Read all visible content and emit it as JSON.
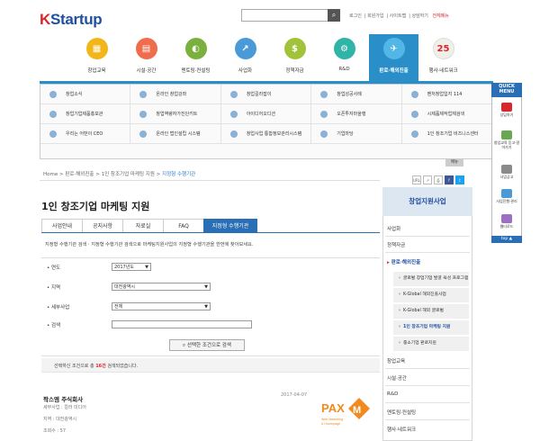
{
  "logo": {
    "k": "K",
    "rest": "Startup"
  },
  "search": {
    "placeholder": "",
    "icon": "search-icon"
  },
  "toplinks": [
    "로그인",
    "회원가입",
    "사이트맵",
    "상담하기",
    "전체메뉴"
  ],
  "gnb": [
    {
      "label": "창업교육",
      "color": "#f2b619",
      "glyph": "▦"
    },
    {
      "label": "시설·공간",
      "color": "#ef6c4c",
      "glyph": "▤"
    },
    {
      "label": "멘토링·컨설팅",
      "color": "#7ab13e",
      "glyph": "◐"
    },
    {
      "label": "사업화",
      "color": "#4b9ad8",
      "glyph": "↗"
    },
    {
      "label": "정책자금",
      "color": "#a0c33a",
      "glyph": "$"
    },
    {
      "label": "R&D",
      "color": "#2fb4a7",
      "glyph": "⚙"
    },
    {
      "label": "판로·해외진출",
      "color": "#52b7e6",
      "glyph": "✈"
    },
    {
      "label": "행사·네트워크",
      "color": "#f0efe8",
      "glyph": "25"
    }
  ],
  "submenu": [
    [
      "창업소식",
      "온라인 창업강좌",
      "창업길라잡이",
      "창업성공사례",
      "벤처창업입지 114"
    ],
    [
      "창업기업제품홍보관",
      "창업역량자가진단키트",
      "아이디어오디션",
      "오픈투자마을행",
      "시제품제작업체검색"
    ],
    [
      "우리는 어떤이 CEO",
      "온라인 법인설립 시스템",
      "창업사업 통합정보관리시스템",
      "기업마당",
      "1인 창조기업 비즈니스센터"
    ]
  ],
  "menu_tag": "메뉴",
  "breadcrumb": {
    "home": "Home",
    "p1": "판로·해외진출",
    "p2": "1인 창조기업 마케팅 지원",
    "current": "지정형 수행기관"
  },
  "share": [
    "URL",
    "",
    "",
    "f",
    "t"
  ],
  "page_title": "1인 창조기업 마케팅 지원",
  "tabs": [
    "사업안내",
    "공지사항",
    "자료실",
    "FAQ",
    "지정형 수행기관"
  ],
  "description": "지정형 수행기관 검색 · 지정형 수행기관 검색으로 마케팅지원사업의 지정형 수행기관을 한번에 찾아보세요.",
  "form": {
    "year_label": "연도",
    "year_value": "2017년도",
    "region_label": "지역",
    "region_value": "대전광역시",
    "detail_label": "세부사업",
    "detail_value": "전체",
    "keyword_label": "검색",
    "keyword_value": ""
  },
  "search_button": "선택한 조건으로 검색",
  "result": {
    "pre": "선택하신 조건으로 총",
    "count": "16건",
    "post": "검색되었습니다."
  },
  "item": {
    "title": "팍스엠 주식회사",
    "date": "2017-04-07",
    "meta1": "세부사업 : 컬러 미디어",
    "meta2": "지역 : 대전광역시",
    "meta3": "조회수 : 57",
    "logo": "PAXM",
    "logo_sub": "Web Marketing & Homepage"
  },
  "sidebar": {
    "title": "창업지원사업",
    "items": [
      "사업화",
      "정책자금",
      "판로·해외진출"
    ],
    "subs": [
      "글로벌 창업기업 발굴 육성 프로그램",
      "K-Global 해외진출사업",
      "K-Global 해외 글로벌",
      "1인 창조기업 마케팅 지원",
      "중소기업 판로지원"
    ],
    "items2": [
      "창업교육",
      "시설·공간",
      "R&D",
      "멘토링·컨설팅",
      "행사·네트워크"
    ]
  },
  "quick": {
    "head": "QUICK MENU",
    "items": [
      "상담하기",
      "창업교육 듣고·알아가기",
      "사업공고",
      "사업진행·관리",
      "웹티로드"
    ],
    "top": "top ▲"
  }
}
